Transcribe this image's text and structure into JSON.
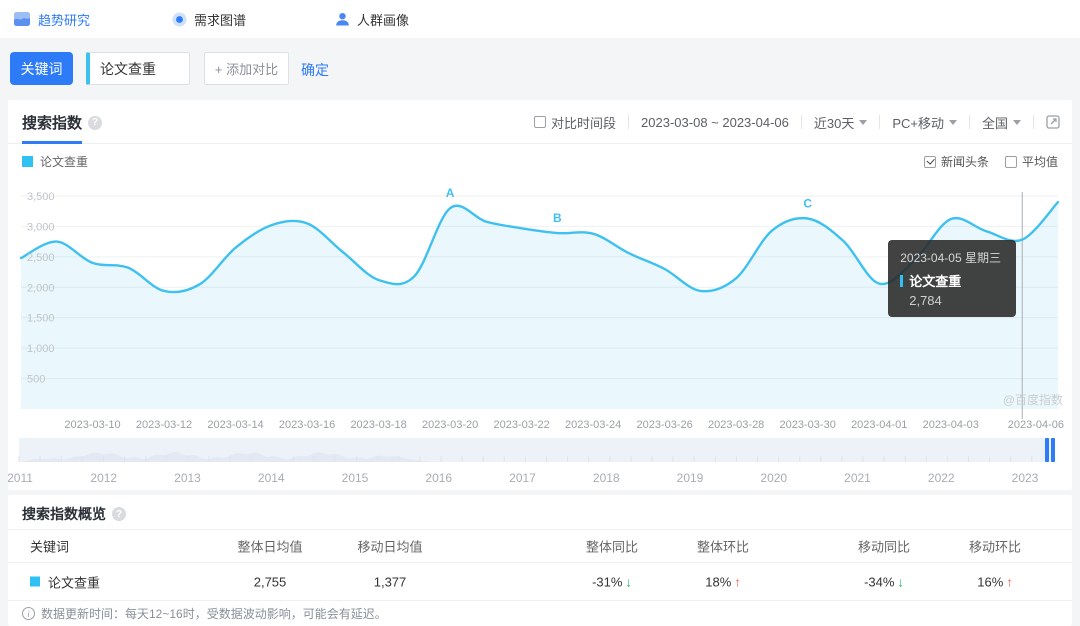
{
  "nav": {
    "items": [
      {
        "label": "趋势研究",
        "active": true,
        "icon": "trend-chart-icon"
      },
      {
        "label": "需求图谱",
        "active": false,
        "icon": "demand-map-icon"
      },
      {
        "label": "人群画像",
        "active": false,
        "icon": "persona-icon"
      }
    ]
  },
  "search_bar": {
    "keyword_button": "关键词",
    "keyword_value": "论文查重",
    "add_compare": "+ 添加对比",
    "confirm": "确定"
  },
  "panel": {
    "tab": "搜索指数",
    "compare_period": "对比时间段",
    "date_range": "2023-03-08 ~ 2023-04-06",
    "range_select": "近30天",
    "device_select": "PC+移动",
    "region_select": "全国",
    "legend": "论文查重",
    "news_checkbox": "新闻头条",
    "avg_checkbox": "平均值",
    "watermark": "@百度指数"
  },
  "tooltip": {
    "date": "2023-04-05 星期三",
    "keyword": "论文查重",
    "value": "2,784"
  },
  "chart_data": {
    "type": "line",
    "title": "搜索指数",
    "x": [
      "2023-03-08",
      "2023-03-09",
      "2023-03-10",
      "2023-03-11",
      "2023-03-12",
      "2023-03-13",
      "2023-03-14",
      "2023-03-15",
      "2023-03-16",
      "2023-03-17",
      "2023-03-18",
      "2023-03-19",
      "2023-03-20",
      "2023-03-21",
      "2023-03-22",
      "2023-03-23",
      "2023-03-24",
      "2023-03-25",
      "2023-03-26",
      "2023-03-27",
      "2023-03-28",
      "2023-03-29",
      "2023-03-30",
      "2023-03-31",
      "2023-04-01",
      "2023-04-02",
      "2023-04-03",
      "2023-04-04",
      "2023-04-05",
      "2023-04-06"
    ],
    "series": [
      {
        "name": "论文查重",
        "color": "#3fc1f0",
        "values": [
          2480,
          2750,
          2400,
          2320,
          1940,
          2050,
          2650,
          3020,
          3050,
          2580,
          2120,
          2180,
          3300,
          3080,
          2970,
          2890,
          2880,
          2560,
          2300,
          1940,
          2150,
          2930,
          3130,
          2760,
          2060,
          2450,
          3120,
          2920,
          2784,
          3400
        ]
      }
    ],
    "ylim": [
      0,
      3500
    ],
    "yticks": [
      500,
      1000,
      1500,
      2000,
      2500,
      3000,
      3500
    ],
    "xtick_labels": [
      "2023-03-10",
      "2023-03-12",
      "2023-03-14",
      "2023-03-16",
      "2023-03-18",
      "2023-03-20",
      "2023-03-22",
      "2023-03-24",
      "2023-03-26",
      "2023-03-28",
      "2023-03-30",
      "2023-04-01",
      "2023-04-03",
      "2023-04-06"
    ],
    "annotations": [
      {
        "label": "A",
        "date": "2023-03-20"
      },
      {
        "label": "B",
        "date": "2023-03-23"
      },
      {
        "label": "C",
        "date": "2023-03-30"
      }
    ],
    "crosshair_date": "2023-04-05",
    "grid": true,
    "legend_position": "top-left"
  },
  "timeline": {
    "years": [
      "2011",
      "2012",
      "2013",
      "2014",
      "2015",
      "2016",
      "2017",
      "2018",
      "2019",
      "2020",
      "2021",
      "2022",
      "2023"
    ]
  },
  "overview": {
    "title": "搜索指数概览",
    "columns": [
      "关键词",
      "整体日均值",
      "移动日均值",
      "整体同比",
      "整体环比",
      "移动同比",
      "移动环比"
    ],
    "rows": [
      {
        "keyword": "论文查重",
        "overall_avg": "2,755",
        "mobile_avg": "1,377",
        "metrics": [
          {
            "text": "-31%",
            "dir": "down"
          },
          {
            "text": "18%",
            "dir": "up"
          },
          {
            "text": "-34%",
            "dir": "down"
          },
          {
            "text": "16%",
            "dir": "up"
          }
        ]
      }
    ]
  },
  "footer": {
    "note": "数据更新时间：每天12~16时，受数据波动影响，可能会有延迟。"
  },
  "colors": {
    "accent_blue": "#2d7bf7",
    "line_cyan": "#3fc1f0",
    "legend_cyan": "#2fc1f3",
    "up_red": "#f5654f",
    "down_green": "#2db36f"
  }
}
